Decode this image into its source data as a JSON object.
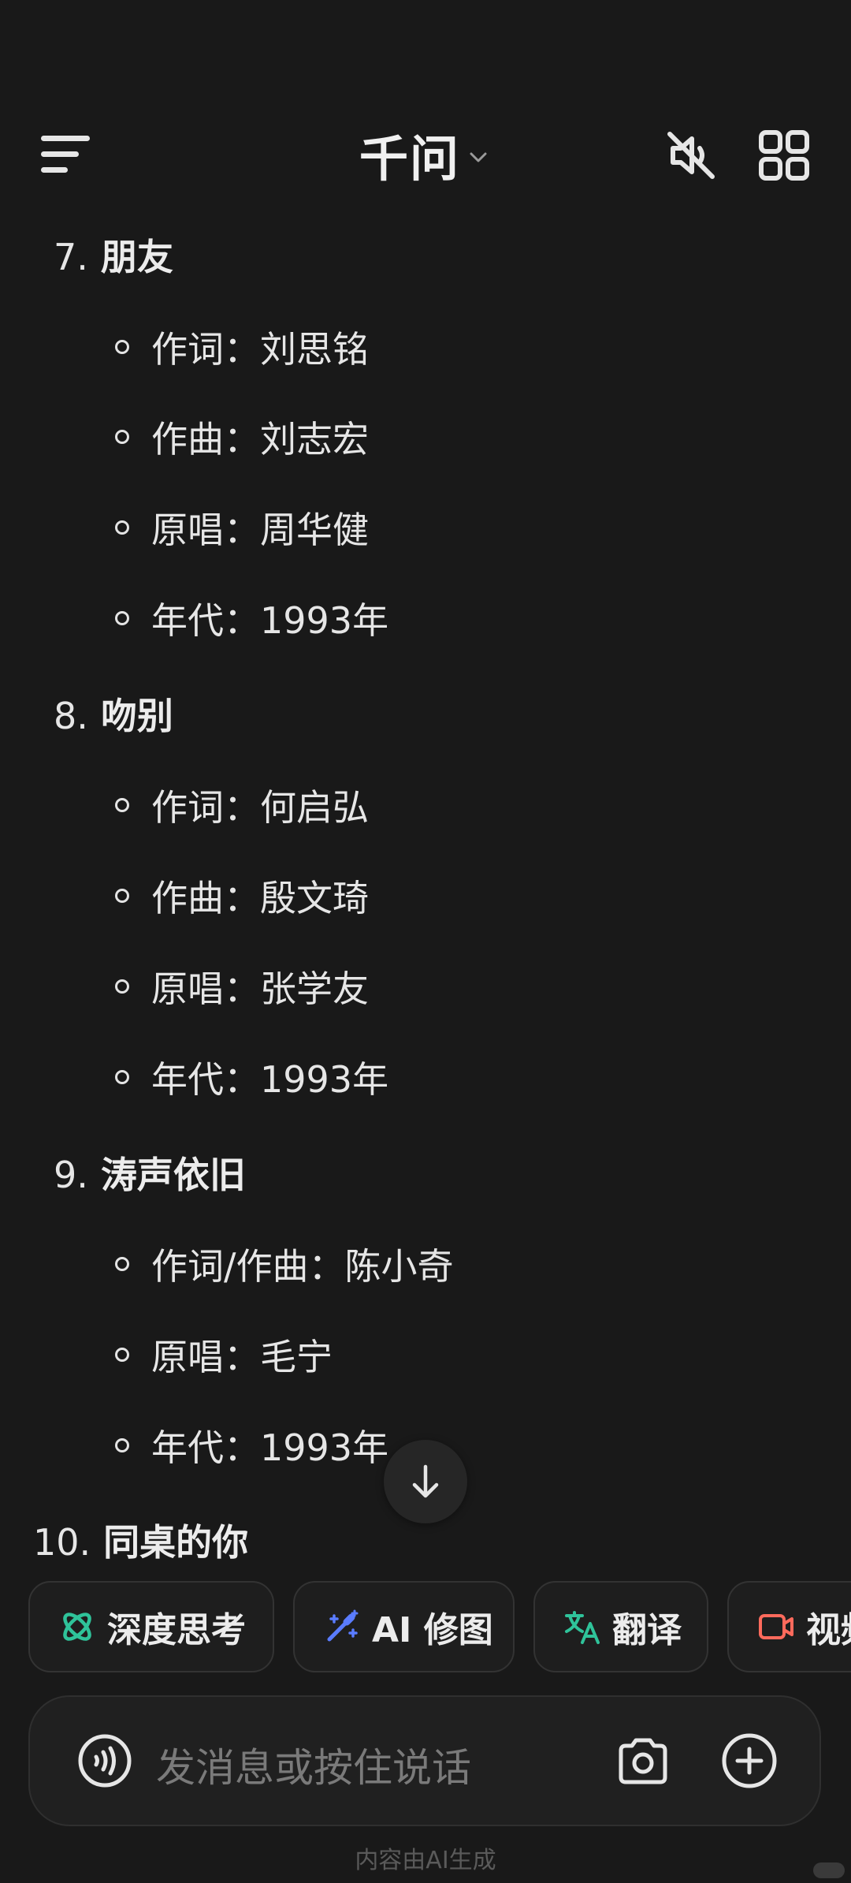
{
  "header": {
    "title": "千问",
    "menu_icon": "menu-icon",
    "chevron_icon": "chevron-down-icon",
    "mute_icon": "speaker-muted-icon",
    "grid_icon": "app-grid-icon"
  },
  "songs": [
    {
      "number": "7.",
      "title": "朋友",
      "details": [
        "作词：刘思铭",
        "作曲：刘志宏",
        "原唱：周华健",
        "年代：1993年"
      ]
    },
    {
      "number": "8.",
      "title": "吻别",
      "details": [
        "作词：何启弘",
        "作曲：殷文琦",
        "原唱：张学友",
        "年代：1993年"
      ]
    },
    {
      "number": "9.",
      "title": "涛声依旧",
      "details": [
        "作词/作曲：陈小奇",
        "原唱：毛宁",
        "年代：1993年"
      ]
    },
    {
      "number": "10.",
      "title": "同桌的你",
      "details": []
    }
  ],
  "scroll_button": {
    "icon": "arrow-down-icon"
  },
  "chips": [
    {
      "label": "深度思考",
      "icon": "atom-icon",
      "color": "#2fc39a"
    },
    {
      "label": "AI 修图",
      "icon": "magic-wand-icon",
      "color": "#5a7cff"
    },
    {
      "label": "翻译",
      "icon": "translate-icon",
      "color": "#2fc39a"
    },
    {
      "label": "视频",
      "icon": "video-call-icon",
      "color": "#ff6a5c"
    }
  ],
  "input": {
    "placeholder": "发消息或按住说话",
    "voice_icon": "voice-wave-icon",
    "camera_icon": "camera-icon",
    "plus_icon": "plus-circle-icon"
  },
  "footer": {
    "disclaimer": "内容由AI生成"
  },
  "colors": {
    "background": "#191919",
    "text": "#e6e6e6",
    "placeholder": "#7a7a7a"
  }
}
